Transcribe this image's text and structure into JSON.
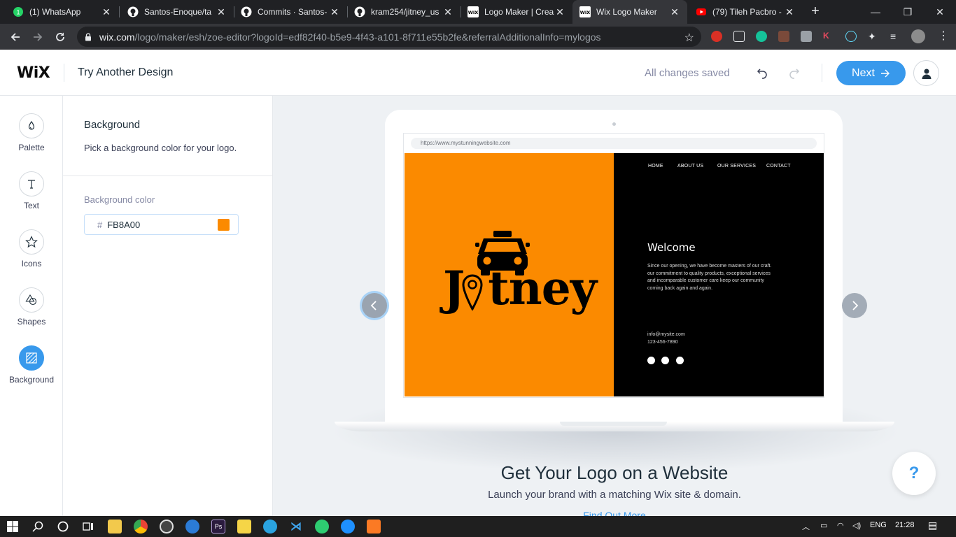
{
  "browser": {
    "tabs": [
      {
        "title": "(1) WhatsApp",
        "favicon": "whatsapp-icon",
        "color": "#25d366"
      },
      {
        "title": "Santos-Enoque/ta",
        "favicon": "github-icon",
        "color": "#ffffff"
      },
      {
        "title": "Commits · Santos-",
        "favicon": "github-icon",
        "color": "#ffffff"
      },
      {
        "title": "kram254/jitney_us",
        "favicon": "github-icon",
        "color": "#ffffff"
      },
      {
        "title": "Logo Maker | Crea",
        "favicon": "wix-icon",
        "color": "#ffffff"
      },
      {
        "title": "Wix Logo Maker",
        "favicon": "wix-icon",
        "color": "#ffffff"
      },
      {
        "title": "(79) Tileh Pacbro -",
        "favicon": "youtube-icon",
        "color": "#ff0000"
      }
    ],
    "url_host": "wix.com",
    "url_path": "/logo/maker/esh/zoe-editor?logoId=edf82f40-b5e9-4f43-a101-8f711e55b2fe&referralAdditionalInfo=mylogos"
  },
  "header": {
    "brand": "WiX",
    "try_another": "Try Another Design",
    "save_status": "All changes saved",
    "next_label": "Next"
  },
  "rail": {
    "items": [
      {
        "label": "Palette",
        "icon": "droplet-icon"
      },
      {
        "label": "Text",
        "icon": "text-icon"
      },
      {
        "label": "Icons",
        "icon": "star-icon"
      },
      {
        "label": "Shapes",
        "icon": "shapes-icon"
      },
      {
        "label": "Background",
        "icon": "background-icon",
        "active": true
      }
    ]
  },
  "panel": {
    "title": "Background",
    "description": "Pick a background color for your logo.",
    "field_label": "Background color",
    "hash": "#",
    "hex_value": "FB8A00",
    "swatch_color": "#fb8a00"
  },
  "preview": {
    "site_url": "https://www.mystunningwebsite.com",
    "nav": [
      "HOME",
      "ABOUT US",
      "OUR SERVICES",
      "CONTACT"
    ],
    "welcome": "Welcome",
    "body_lines": [
      "Since our opening, we have become masters of our craft.",
      "our commitment to quality products, exceptional services",
      "and incomparable customer care keep our community",
      "coming back again and again."
    ],
    "email": "info@mysite.com",
    "phone": "123-456-7890",
    "logo_text_pre": "J",
    "logo_text_post": "tney",
    "logo_bg": "#fb8a00"
  },
  "promo": {
    "title": "Get Your Logo on a Website",
    "subtitle": "Launch your brand with a matching Wix site & domain.",
    "link": "Find Out More"
  },
  "help_label": "?",
  "taskbar": {
    "language": "ENG",
    "time": "21:28"
  }
}
